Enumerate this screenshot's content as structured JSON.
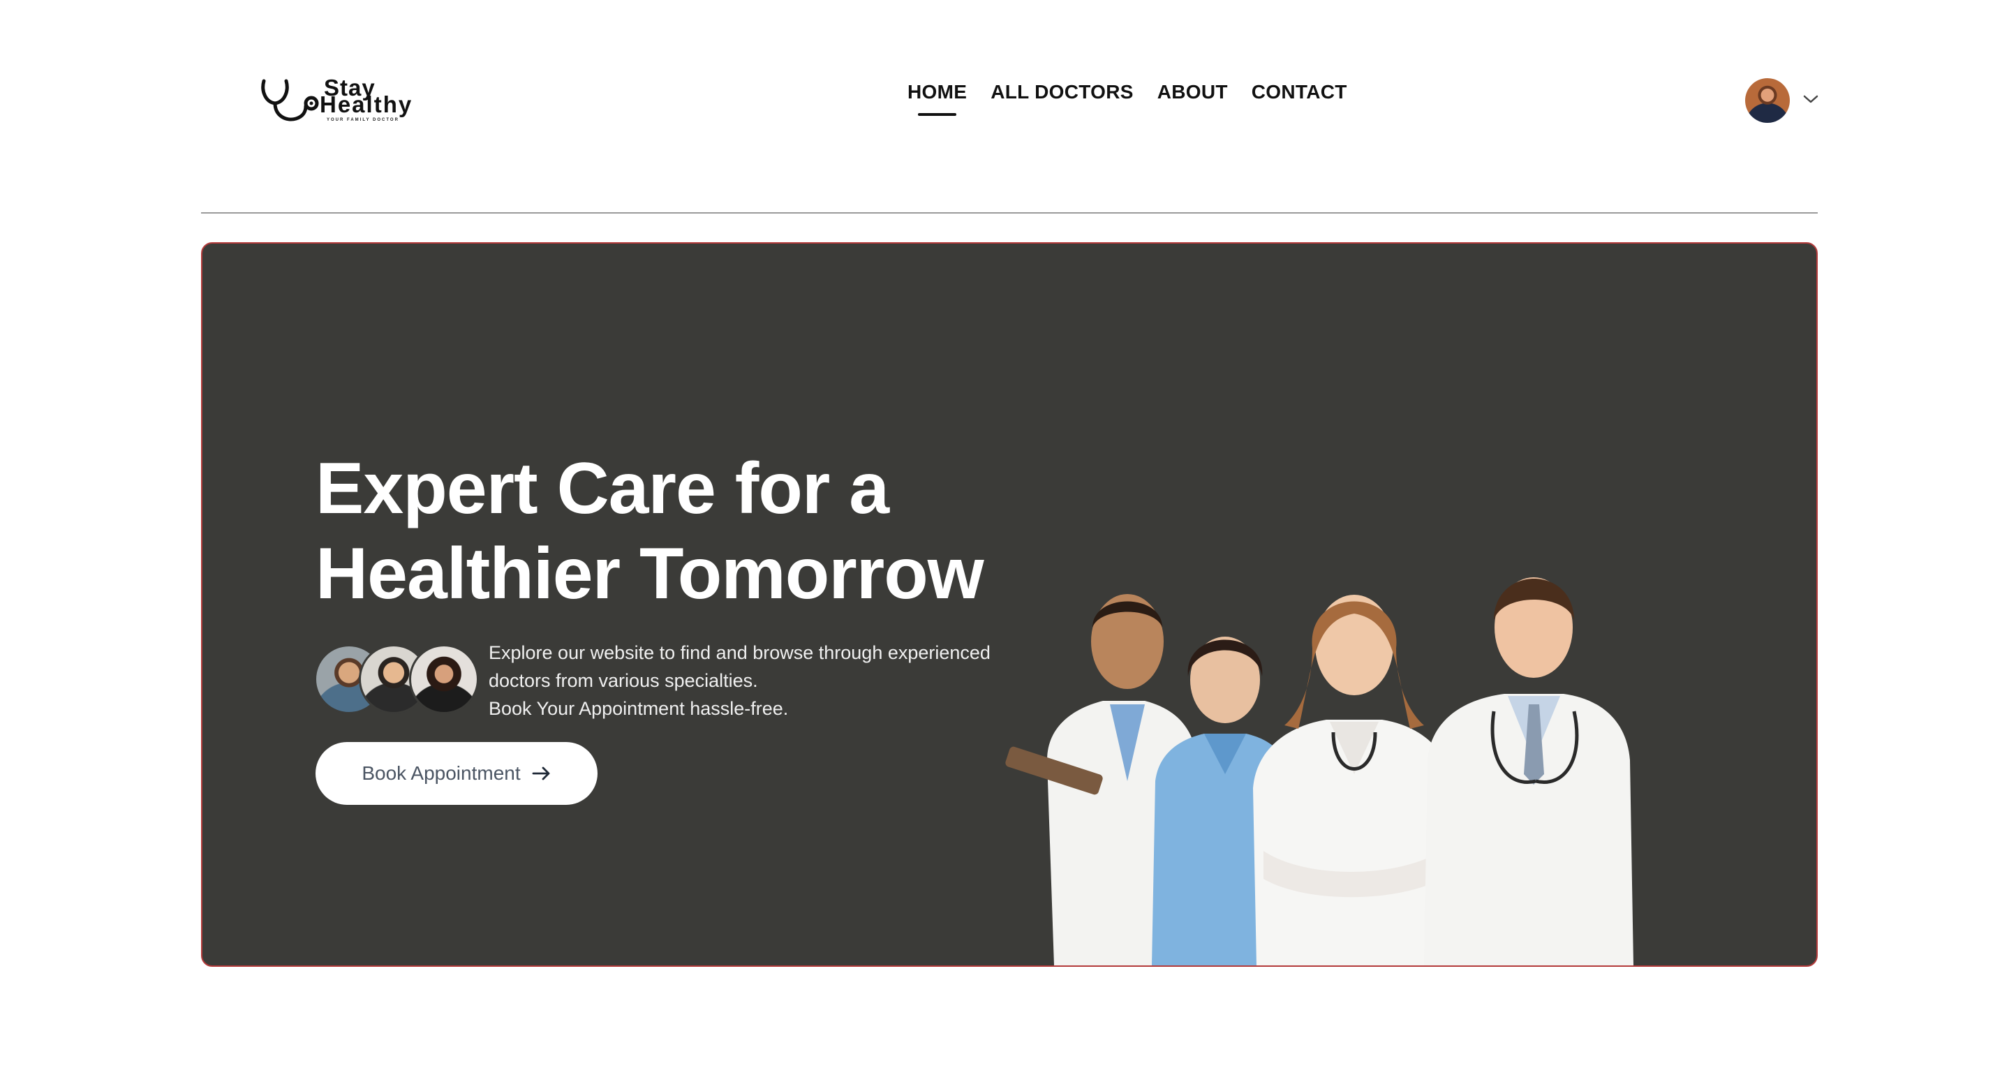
{
  "header": {
    "logo": {
      "word1": "Stay",
      "word2": "Healthy",
      "tagline": "YOUR FAMILY DOCTOR",
      "icon": "stethoscope-icon"
    },
    "nav": [
      {
        "label": "HOME",
        "active": true
      },
      {
        "label": "ALL DOCTORS",
        "active": false
      },
      {
        "label": "ABOUT",
        "active": false
      },
      {
        "label": "CONTACT",
        "active": false
      }
    ],
    "profile": {
      "chevron_icon": "chevron-down-icon"
    }
  },
  "hero": {
    "title_line1": "Expert Care for a",
    "title_line2": "Healthier Tomorrow",
    "desc_line1": "Explore our website to find and browse through experienced",
    "desc_line2": "doctors from various specialties.",
    "desc_line3": "Book Your Appointment hassle-free.",
    "cta_label": "Book Appointment",
    "cta_icon": "arrow-right-icon"
  },
  "colors": {
    "hero_bg": "#3b3b38",
    "hero_border": "#b33a3a",
    "text_dark": "#111111",
    "button_bg": "#ffffff",
    "button_text": "#4b5563"
  }
}
